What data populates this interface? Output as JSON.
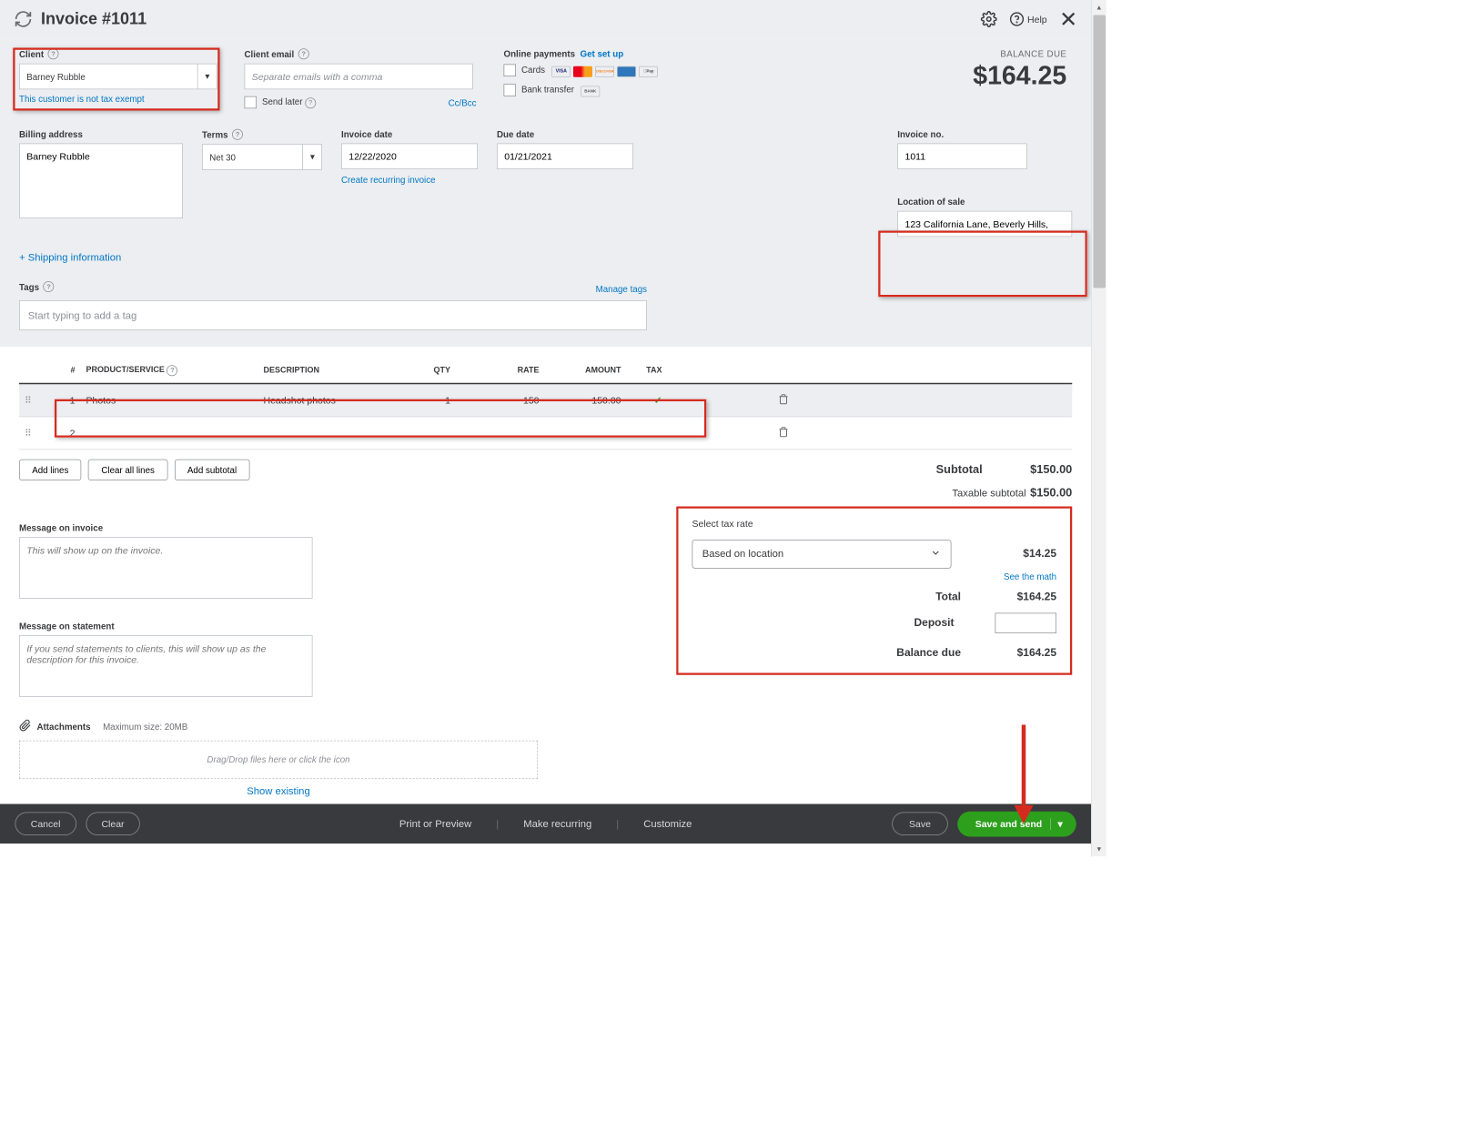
{
  "header": {
    "title": "Invoice #1011",
    "help_label": "Help"
  },
  "client": {
    "label": "Client",
    "value": "Barney Rubble",
    "not_exempt": "This customer is not tax exempt",
    "email_label": "Client email",
    "email_placeholder": "Separate emails with a comma",
    "send_later": "Send later",
    "ccbcc": "Cc/Bcc"
  },
  "payments": {
    "label": "Online payments",
    "setup": "Get set up",
    "cards": "Cards",
    "bank": "Bank transfer"
  },
  "balance": {
    "label": "BALANCE DUE",
    "amount": "$164.25"
  },
  "billing": {
    "label": "Billing address",
    "value": "Barney Rubble"
  },
  "terms": {
    "label": "Terms",
    "value": "Net 30"
  },
  "invoice_date": {
    "label": "Invoice date",
    "value": "12/22/2020",
    "recurring": "Create recurring invoice"
  },
  "due_date": {
    "label": "Due date",
    "value": "01/21/2021"
  },
  "invoice_no": {
    "label": "Invoice no.",
    "value": "1011"
  },
  "location": {
    "label": "Location of sale",
    "value": "123 California Lane, Beverly Hills,"
  },
  "shipping_link": "+ Shipping information",
  "tags": {
    "label": "Tags",
    "manage": "Manage tags",
    "placeholder": "Start typing to add a tag"
  },
  "columns": {
    "num": "#",
    "product": "PRODUCT/SERVICE",
    "desc": "DESCRIPTION",
    "qty": "QTY",
    "rate": "RATE",
    "amount": "AMOUNT",
    "tax": "TAX"
  },
  "rows": [
    {
      "n": "1",
      "product": "Photos",
      "desc": "Headshot photos",
      "qty": "1",
      "rate": "150",
      "amount": "150.00",
      "tax": true
    },
    {
      "n": "2",
      "product": "",
      "desc": "",
      "qty": "",
      "rate": "",
      "amount": "",
      "tax": false
    }
  ],
  "table_buttons": {
    "add_lines": "Add lines",
    "clear": "Clear all lines",
    "subtotal": "Add subtotal"
  },
  "subtotal": {
    "label": "Subtotal",
    "value": "$150.00"
  },
  "taxable_sub": {
    "label": "Taxable subtotal",
    "value": "$150.00"
  },
  "message_invoice": {
    "label": "Message on invoice",
    "placeholder": "This will show up on the invoice."
  },
  "message_statement": {
    "label": "Message on statement",
    "placeholder": "If you send statements to clients, this will show up as the description for this invoice."
  },
  "tax": {
    "title": "Select tax rate",
    "rate_value": "Based on location",
    "amount": "$14.25",
    "see_math": "See the math",
    "total_label": "Total",
    "total_value": "$164.25",
    "deposit_label": "Deposit",
    "balance_label": "Balance due",
    "balance_value": "$164.25"
  },
  "attachments": {
    "label": "Attachments",
    "hint": "Maximum size: 20MB",
    "drop": "Drag/Drop files here or click the icon",
    "show": "Show existing"
  },
  "footer": {
    "cancel": "Cancel",
    "clear": "Clear",
    "print": "Print or Preview",
    "recurring": "Make recurring",
    "customize": "Customize",
    "save": "Save",
    "save_send": "Save and send"
  }
}
